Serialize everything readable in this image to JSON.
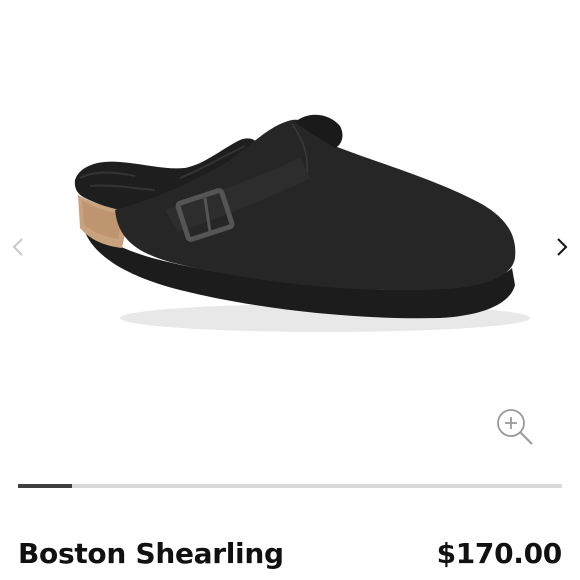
{
  "gallery": {
    "image": {
      "icon": "clog-shoe-image"
    },
    "prev_icon": "chevron-left-icon",
    "next_icon": "chevron-right-icon",
    "zoom_icon": "zoom-in-icon",
    "progress": {
      "current": 1,
      "total": 7,
      "fraction": 0.1
    }
  },
  "product": {
    "name": "Boston Shearling",
    "price": "$170.00"
  },
  "colors": {
    "text": "#111111",
    "progress_fill": "#3f3f3f",
    "progress_track": "#d9d9d9",
    "arrow_inactive": "#c8c8c8",
    "arrow_active": "#111111"
  }
}
